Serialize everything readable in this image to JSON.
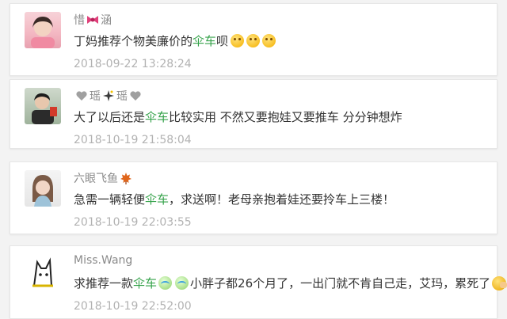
{
  "comments": [
    {
      "name_before": "惜",
      "name_after": "涵",
      "name_emoji": "bow-icon",
      "text_before": "丁妈推荐个物美廉价的",
      "keyword": "伞车",
      "text_after": "呗",
      "emojis": [
        "smile-icon",
        "smile-icon",
        "smile-icon"
      ],
      "timestamp": "2018-09-22 13:28:24"
    },
    {
      "name_parts": [
        "瑶",
        "瑶"
      ],
      "name_emojis": [
        "heart-icon",
        "sparkle-icon",
        "heart-icon"
      ],
      "text_before": "大了以后还是",
      "keyword": "伞车",
      "text_after": "比较实用 不然又要抱娃又要推车 分分钟想炸",
      "timestamp": "2018-10-19 21:58:04"
    },
    {
      "name": "六眼飞鱼",
      "name_emoji": "maple-leaf-icon",
      "text_before": "急需一辆轻便",
      "keyword": "伞车",
      "text_after": "，求送啊！老母亲抱着娃还要拎车上三楼！",
      "timestamp": "2018-10-19 22:03:55"
    },
    {
      "name": "Miss.Wang",
      "text_before": "求推荐一款",
      "keyword": "伞车",
      "text_middle": "小胖子都26个月了，一出门就不肯自己走，艾玛，累死了",
      "emojis": [
        "cry-icon",
        "cry-icon",
        "facepalm-icon"
      ],
      "timestamp": "2018-10-19 22:52:00"
    }
  ],
  "colors": {
    "keyword": "#35a24a",
    "name": "#8a8a8a",
    "timestamp": "#b2b2b2",
    "text": "#333333"
  }
}
